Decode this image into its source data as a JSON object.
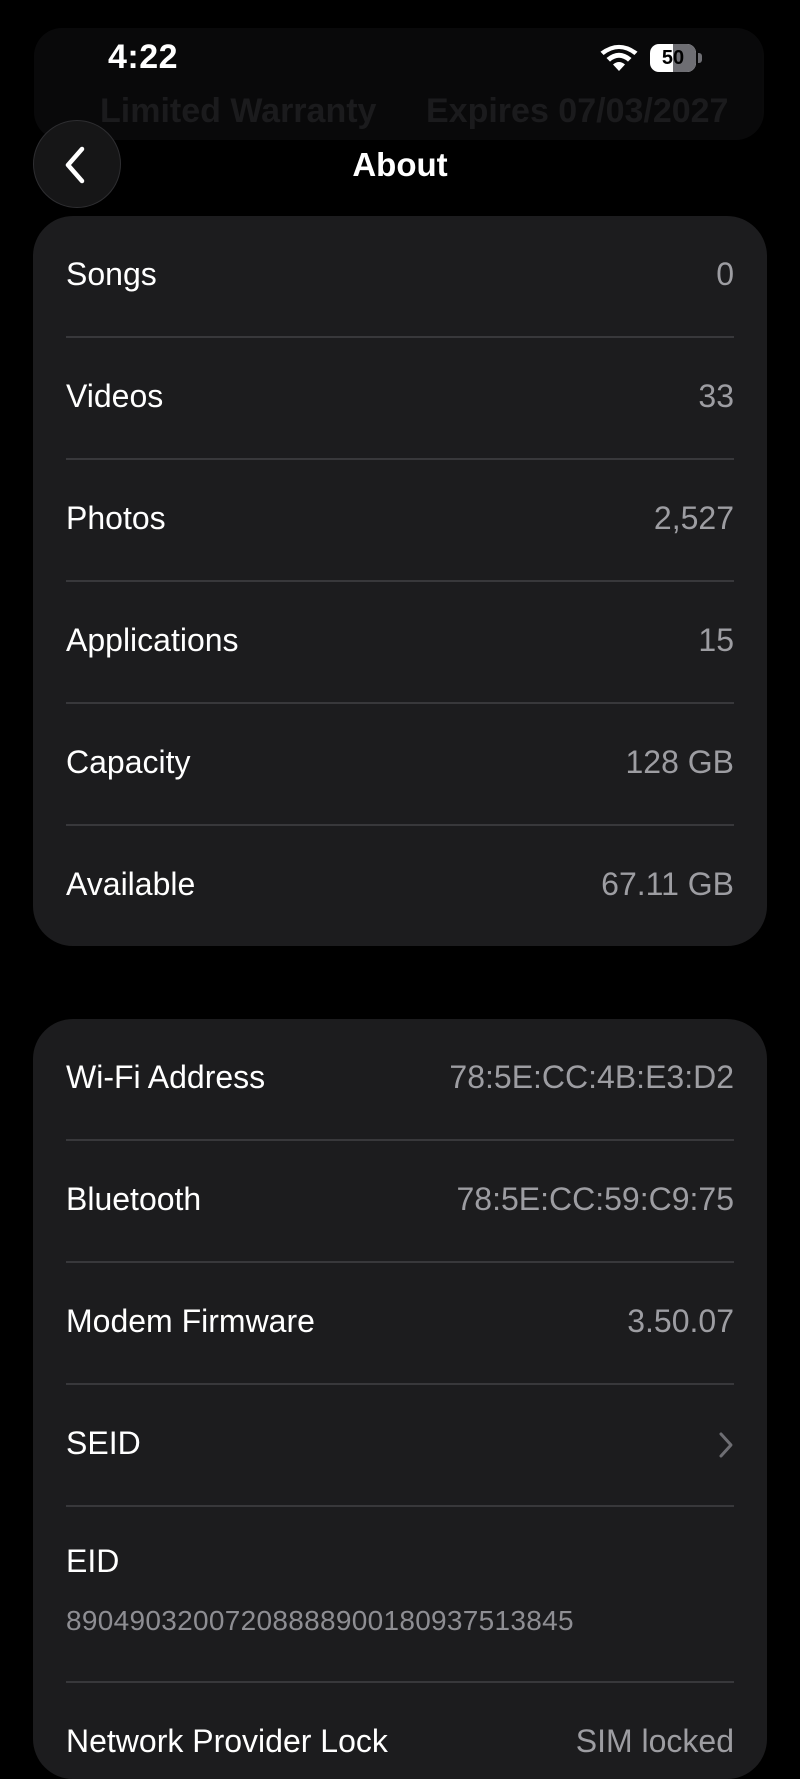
{
  "status_bar": {
    "time": "4:22",
    "battery_level": "50",
    "battery_fraction": 0.5,
    "wifi_icon": "wifi-icon"
  },
  "ghost_banner": {
    "left": "Limited Warranty",
    "right": "Expires 07/03/2027"
  },
  "nav": {
    "back_icon": "chevron-left-icon",
    "title": "About"
  },
  "card1": {
    "rows": [
      {
        "label": "Songs",
        "value": "0"
      },
      {
        "label": "Videos",
        "value": "33"
      },
      {
        "label": "Photos",
        "value": "2,527"
      },
      {
        "label": "Applications",
        "value": "15"
      },
      {
        "label": "Capacity",
        "value": "128 GB"
      },
      {
        "label": "Available",
        "value": "67.11 GB"
      }
    ]
  },
  "card2": {
    "rows": [
      {
        "label": "Wi-Fi Address",
        "value": "78:5E:CC:4B:E3:D2"
      },
      {
        "label": "Bluetooth",
        "value": "78:5E:CC:59:C9:75"
      },
      {
        "label": "Modem Firmware",
        "value": "3.50.07"
      },
      {
        "label": "SEID",
        "icon": "chevron-right-icon"
      },
      {
        "label": "EID",
        "value": "89049032007208888900180937513845"
      },
      {
        "label": "Network Provider Lock",
        "value": "SIM locked"
      }
    ]
  },
  "colors": {
    "background": "#000000",
    "card": "#1c1c1e",
    "label": "#ffffff",
    "value": "#9d9da2",
    "divider": "#38383b"
  }
}
